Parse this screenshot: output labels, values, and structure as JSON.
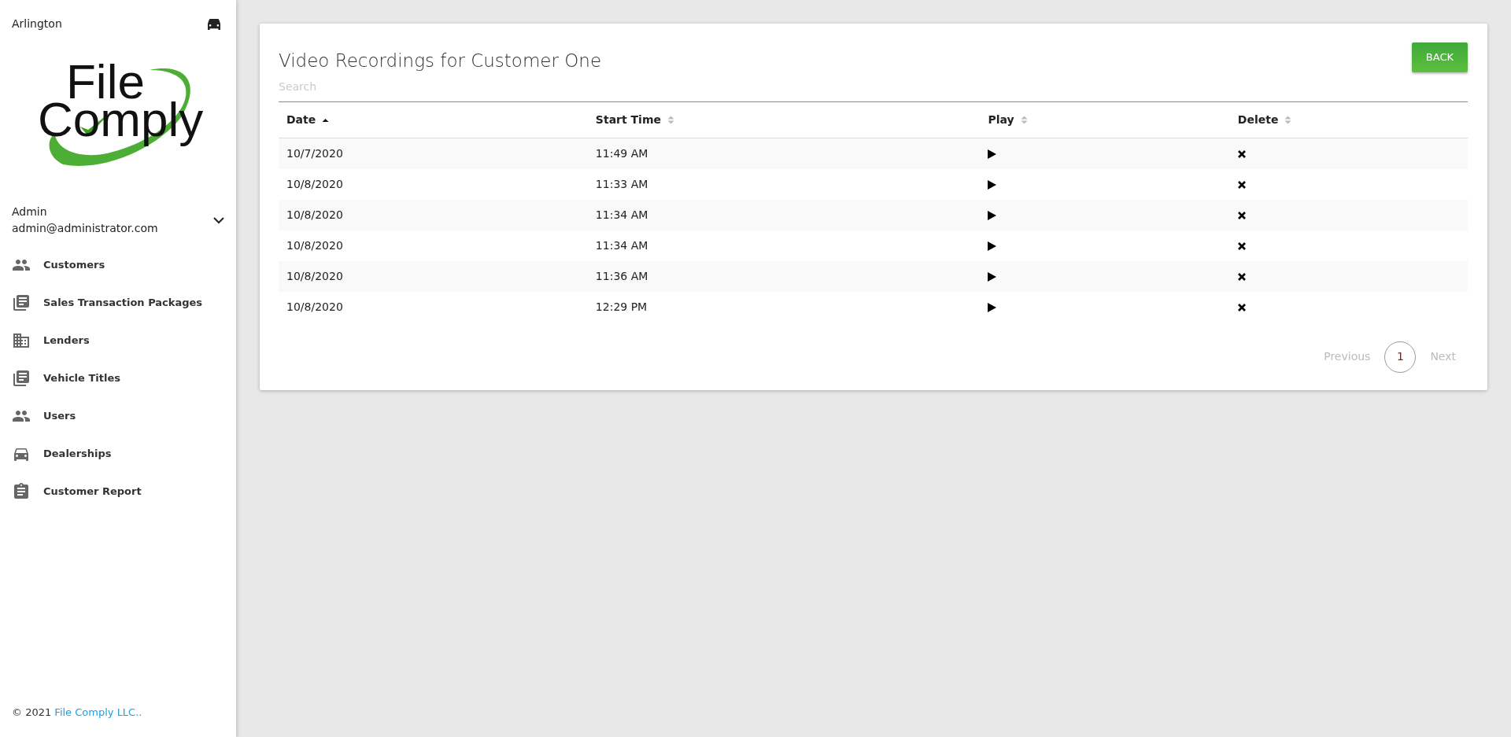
{
  "sidebar": {
    "location": "Arlington",
    "logo": {
      "line_1": "File",
      "line_2": "Comply"
    },
    "user": {
      "name": "Admin",
      "email": "admin@administrator.com",
      "expanded": false
    },
    "items": [
      {
        "label": "Customers"
      },
      {
        "label": "Sales Transaction Packages"
      },
      {
        "label": "Lenders"
      },
      {
        "label": "Vehicle Titles"
      },
      {
        "label": "Users"
      },
      {
        "label": "Dealerships"
      },
      {
        "label": "Customer Report"
      }
    ],
    "footer": {
      "text": "© 2021",
      "link": "File Comply LLC.."
    }
  },
  "main": {
    "title": "Video Recordings for Customer One",
    "back_button": "BACK",
    "search": {
      "placeholder": "Search"
    },
    "table": {
      "columns": [
        {
          "label": "Date",
          "sorted": true
        },
        {
          "label": "Start Time",
          "sorted": false
        },
        {
          "label": "Play",
          "sorted": false
        },
        {
          "label": "Delete",
          "sorted": false
        }
      ],
      "rows": [
        {
          "date": "10/7/2020",
          "start_time": "11:49 AM"
        },
        {
          "date": "10/8/2020",
          "start_time": "11:33 AM"
        },
        {
          "date": "10/8/2020",
          "start_time": "11:34 AM"
        },
        {
          "date": "10/8/2020",
          "start_time": "11:34 AM"
        },
        {
          "date": "10/8/2020",
          "start_time": "11:36 AM"
        },
        {
          "date": "10/8/2020",
          "start_time": "12:29 PM"
        }
      ]
    },
    "pagination": {
      "previous": {
        "label": "Previous",
        "disabled": true
      },
      "pages": [
        {
          "label": "1",
          "selected": true
        }
      ],
      "next": {
        "label": "Next",
        "disabled": true
      }
    }
  }
}
